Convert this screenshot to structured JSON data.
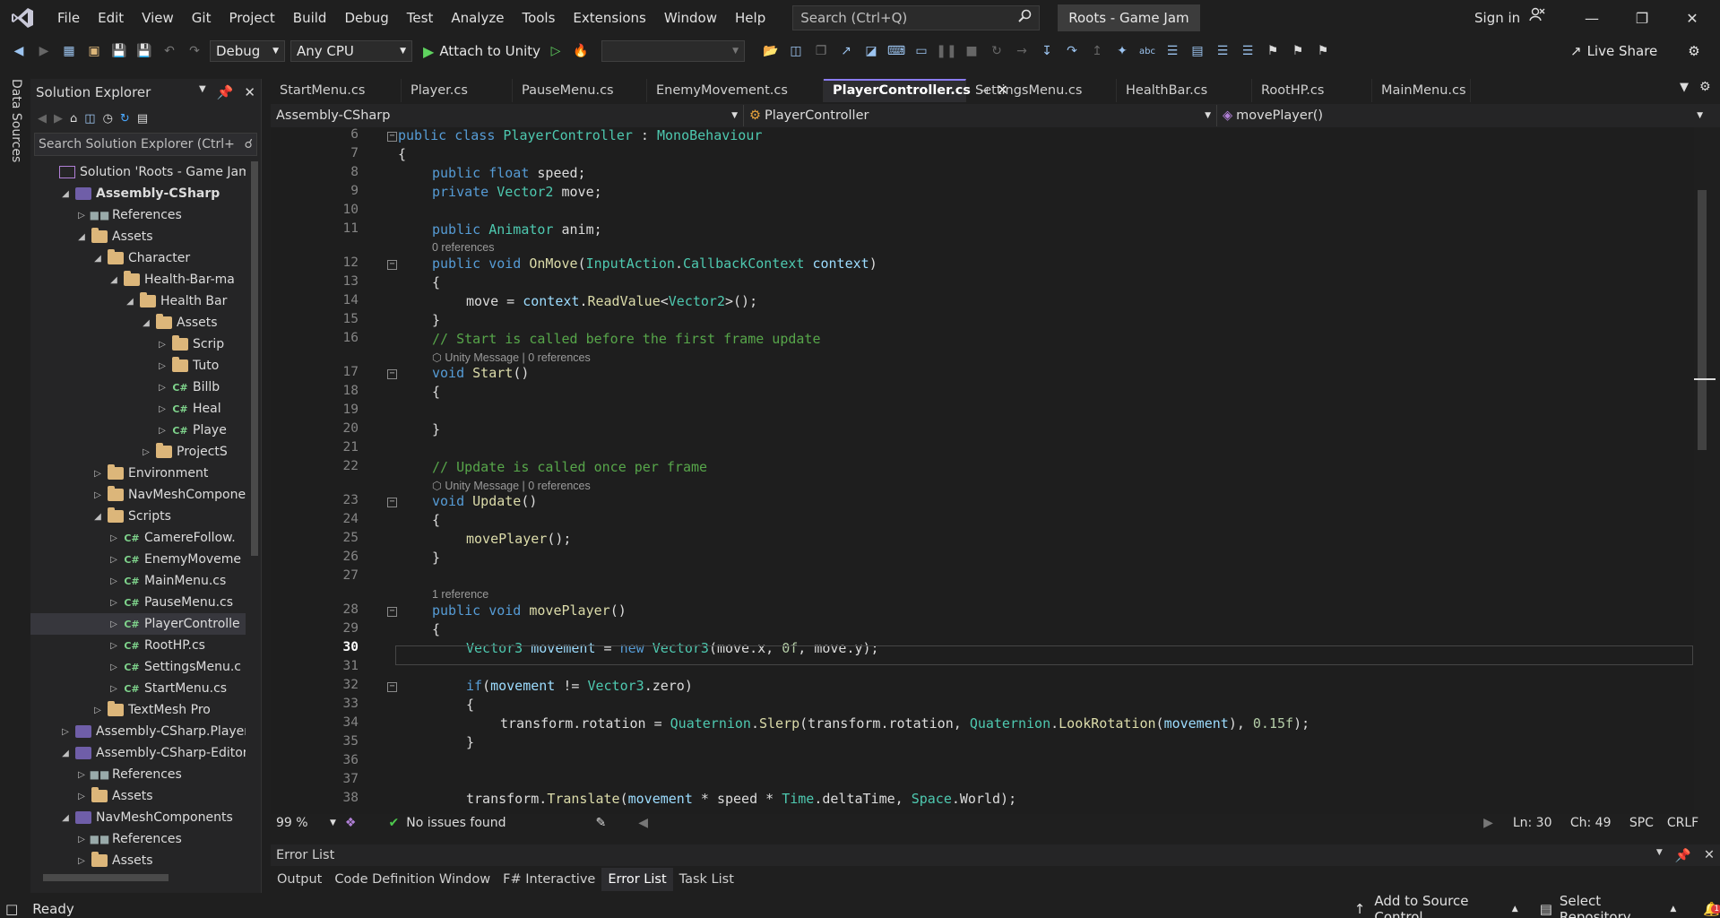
{
  "menu": [
    "File",
    "Edit",
    "View",
    "Git",
    "Project",
    "Build",
    "Debug",
    "Test",
    "Analyze",
    "Tools",
    "Extensions",
    "Window",
    "Help"
  ],
  "search": {
    "placeholder": "Search (Ctrl+Q)"
  },
  "solution_title": "Roots - Game Jam",
  "signin": "Sign in",
  "toolbar": {
    "config": "Debug",
    "platform": "Any CPU",
    "attach": "Attach to Unity",
    "liveshare": "Live Share"
  },
  "side_strip": "Data Sources",
  "solution_explorer": {
    "title": "Solution Explorer",
    "search_placeholder": "Search Solution Explorer (Ctrl+",
    "items": [
      {
        "label": "Solution 'Roots - Game Jam'",
        "indent": 0,
        "arrow": "",
        "icon": "sol"
      },
      {
        "label": "Assembly-CSharp",
        "indent": 1,
        "arrow": "◢",
        "icon": "proj",
        "bold": true
      },
      {
        "label": "References",
        "indent": 2,
        "arrow": "▷",
        "icon": "refs"
      },
      {
        "label": "Assets",
        "indent": 2,
        "arrow": "◢",
        "icon": "folder"
      },
      {
        "label": "Character",
        "indent": 3,
        "arrow": "◢",
        "icon": "folder"
      },
      {
        "label": "Health-Bar-ma",
        "indent": 4,
        "arrow": "◢",
        "icon": "folder"
      },
      {
        "label": "Health Bar",
        "indent": 5,
        "arrow": "◢",
        "icon": "folder"
      },
      {
        "label": "Assets",
        "indent": 6,
        "arrow": "◢",
        "icon": "folder"
      },
      {
        "label": "Scrip",
        "indent": 7,
        "arrow": "▷",
        "icon": "folder"
      },
      {
        "label": "Tuto",
        "indent": 7,
        "arrow": "▷",
        "icon": "folder"
      },
      {
        "label": "Billb",
        "indent": 7,
        "arrow": "▷",
        "icon": "cs"
      },
      {
        "label": "Heal",
        "indent": 7,
        "arrow": "▷",
        "icon": "cs"
      },
      {
        "label": "Playe",
        "indent": 7,
        "arrow": "▷",
        "icon": "cs"
      },
      {
        "label": "ProjectS",
        "indent": 6,
        "arrow": "▷",
        "icon": "folder"
      },
      {
        "label": "Environment",
        "indent": 3,
        "arrow": "▷",
        "icon": "folder"
      },
      {
        "label": "NavMeshCompone",
        "indent": 3,
        "arrow": "▷",
        "icon": "folder"
      },
      {
        "label": "Scripts",
        "indent": 3,
        "arrow": "◢",
        "icon": "folder"
      },
      {
        "label": "CamereFollow.",
        "indent": 4,
        "arrow": "▷",
        "icon": "cs"
      },
      {
        "label": "EnemyMoveme",
        "indent": 4,
        "arrow": "▷",
        "icon": "cs"
      },
      {
        "label": "MainMenu.cs",
        "indent": 4,
        "arrow": "▷",
        "icon": "cs"
      },
      {
        "label": "PauseMenu.cs",
        "indent": 4,
        "arrow": "▷",
        "icon": "cs"
      },
      {
        "label": "PlayerControlle",
        "indent": 4,
        "arrow": "▷",
        "icon": "cs",
        "selected": true
      },
      {
        "label": "RootHP.cs",
        "indent": 4,
        "arrow": "▷",
        "icon": "cs"
      },
      {
        "label": "SettingsMenu.c",
        "indent": 4,
        "arrow": "▷",
        "icon": "cs"
      },
      {
        "label": "StartMenu.cs",
        "indent": 4,
        "arrow": "▷",
        "icon": "cs"
      },
      {
        "label": "TextMesh Pro",
        "indent": 3,
        "arrow": "▷",
        "icon": "folder"
      },
      {
        "label": "Assembly-CSharp.Player",
        "indent": 1,
        "arrow": "▷",
        "icon": "proj"
      },
      {
        "label": "Assembly-CSharp-Editor",
        "indent": 1,
        "arrow": "◢",
        "icon": "proj"
      },
      {
        "label": "References",
        "indent": 2,
        "arrow": "▷",
        "icon": "refs"
      },
      {
        "label": "Assets",
        "indent": 2,
        "arrow": "▷",
        "icon": "folder"
      },
      {
        "label": "NavMeshComponents",
        "indent": 1,
        "arrow": "◢",
        "icon": "proj"
      },
      {
        "label": "References",
        "indent": 2,
        "arrow": "▷",
        "icon": "refs"
      },
      {
        "label": "Assets",
        "indent": 2,
        "arrow": "▷",
        "icon": "folder"
      }
    ]
  },
  "tabs": [
    {
      "label": "StartMenu.cs",
      "active": false
    },
    {
      "label": "Player.cs",
      "active": false
    },
    {
      "label": "PauseMenu.cs",
      "active": false
    },
    {
      "label": "EnemyMovement.cs",
      "active": false
    },
    {
      "label": "PlayerController.cs",
      "active": true
    },
    {
      "label": "SettingsMenu.cs",
      "active": false
    },
    {
      "label": "HealthBar.cs",
      "active": false
    },
    {
      "label": "RootHP.cs",
      "active": false
    },
    {
      "label": "MainMenu.cs",
      "active": false
    }
  ],
  "navbar": {
    "project": "Assembly-CSharp",
    "class": "PlayerController",
    "member": "movePlayer()"
  },
  "code": [
    {
      "type": "line",
      "n": "6",
      "fold": true,
      "html": "<span class='kw'>public class</span> <span class='ty'>PlayerController</span> : <span class='ty'>MonoBehaviour</span>",
      "indent": 0
    },
    {
      "type": "line",
      "n": "7",
      "html": "{",
      "indent": 0
    },
    {
      "type": "line",
      "n": "8",
      "html": "<span class='kw'>public float</span> speed;",
      "indent": 1
    },
    {
      "type": "line",
      "n": "9",
      "html": "<span class='kw'>private</span> <span class='ty'>Vector2</span> move;",
      "indent": 1
    },
    {
      "type": "line",
      "n": "10",
      "html": "",
      "indent": 1
    },
    {
      "type": "line",
      "n": "11",
      "html": "<span class='kw'>public</span> <span class='ty'>Animator</span> anim;",
      "indent": 1
    },
    {
      "type": "lens",
      "text": "0 references"
    },
    {
      "type": "line",
      "n": "12",
      "fold": true,
      "html": "<span class='kw'>public void</span> <span class='mt'>OnMove</span>(<span class='ty'>InputAction</span>.<span class='ty'>CallbackContext</span> <span class='pm'>context</span>)",
      "indent": 1
    },
    {
      "type": "line",
      "n": "13",
      "html": "{",
      "indent": 1
    },
    {
      "type": "line",
      "n": "14",
      "html": "move = <span class='pm'>context</span>.<span class='mt'>ReadValue</span>&lt;<span class='ty'>Vector2</span>&gt;();",
      "indent": 2
    },
    {
      "type": "line",
      "n": "15",
      "html": "}",
      "indent": 1
    },
    {
      "type": "line",
      "n": "16",
      "html": "<span class='cm'>// Start is called before the first frame update</span>",
      "indent": 1
    },
    {
      "type": "lens",
      "text": "⬡ Unity Message | 0 references"
    },
    {
      "type": "line",
      "n": "17",
      "fold": true,
      "html": "<span class='kw'>void</span> <span class='mt'>Start</span>()",
      "indent": 1
    },
    {
      "type": "line",
      "n": "18",
      "html": "{",
      "indent": 1
    },
    {
      "type": "line",
      "n": "19",
      "html": "",
      "indent": 1
    },
    {
      "type": "line",
      "n": "20",
      "html": "}",
      "indent": 1
    },
    {
      "type": "line",
      "n": "21",
      "html": "",
      "indent": 1
    },
    {
      "type": "line",
      "n": "22",
      "html": "<span class='cm'>// Update is called once per frame</span>",
      "indent": 1
    },
    {
      "type": "lens",
      "text": "⬡ Unity Message | 0 references"
    },
    {
      "type": "line",
      "n": "23",
      "fold": true,
      "html": "<span class='kw'>void</span> <span class='mt'>Update</span>()",
      "indent": 1
    },
    {
      "type": "line",
      "n": "24",
      "html": "{",
      "indent": 1
    },
    {
      "type": "line",
      "n": "25",
      "html": "<span class='mt'>movePlayer</span>();",
      "indent": 2
    },
    {
      "type": "line",
      "n": "26",
      "html": "}",
      "indent": 1
    },
    {
      "type": "line",
      "n": "27",
      "html": "",
      "indent": 1
    },
    {
      "type": "lens",
      "text": "1 reference"
    },
    {
      "type": "line",
      "n": "28",
      "fold": true,
      "html": "<span class='kw'>public void</span> <span class='mt'>movePlayer</span>()",
      "indent": 1
    },
    {
      "type": "line",
      "n": "29",
      "html": "{",
      "indent": 1
    },
    {
      "type": "line",
      "n": "30",
      "cur": true,
      "html": "<span class='ty'>Vector3</span> <span class='pm'>movement</span> = <span class='kw'>new</span> <span class='ty'>Vector3</span>(move.x, <span class='nm'>0f</span>, move.y);",
      "indent": 2
    },
    {
      "type": "line",
      "n": "31",
      "html": "",
      "indent": 2
    },
    {
      "type": "line",
      "n": "32",
      "fold": true,
      "html": "<span class='kw'>if</span>(<span class='pm'>movement</span> != <span class='ty'>Vector3</span>.zero)",
      "indent": 2
    },
    {
      "type": "line",
      "n": "33",
      "html": "{",
      "indent": 2
    },
    {
      "type": "line",
      "n": "34",
      "html": "transform.rotation = <span class='ty'>Quaternion</span>.<span class='mt'>Slerp</span>(transform.rotation, <span class='ty'>Quaternion</span>.<span class='mt'>LookRotation</span>(<span class='pm'>movement</span>), <span class='nm'>0.15f</span>);",
      "indent": 3
    },
    {
      "type": "line",
      "n": "35",
      "html": "}",
      "indent": 2
    },
    {
      "type": "line",
      "n": "36",
      "html": "",
      "indent": 2
    },
    {
      "type": "line",
      "n": "37",
      "html": "",
      "indent": 2
    },
    {
      "type": "line",
      "n": "38",
      "html": "transform.<span class='mt'>Translate</span>(<span class='pm'>movement</span> * speed * <span class='ty'>Time</span>.deltaTime, <span class='ty'>Space</span>.World);",
      "indent": 2
    }
  ],
  "editor_status": {
    "zoom": "99 %",
    "issues": "No issues found",
    "line": "Ln: 30",
    "col": "Ch: 49",
    "spc": "SPC",
    "eol": "CRLF"
  },
  "error_list": {
    "title": "Error List"
  },
  "panel_tabs": [
    {
      "label": "Output",
      "active": false
    },
    {
      "label": "Code Definition Window",
      "active": false
    },
    {
      "label": "F# Interactive",
      "active": false
    },
    {
      "label": "Error List",
      "active": true
    },
    {
      "label": "Task List",
      "active": false
    }
  ],
  "status": {
    "ready": "Ready",
    "source_control": "Add to Source Control",
    "repo": "Select Repository",
    "notifications": "1"
  },
  "colors": {
    "accent": "#8a7cf0",
    "background": "#1f1f1f",
    "editor": "#1e1e1e"
  }
}
